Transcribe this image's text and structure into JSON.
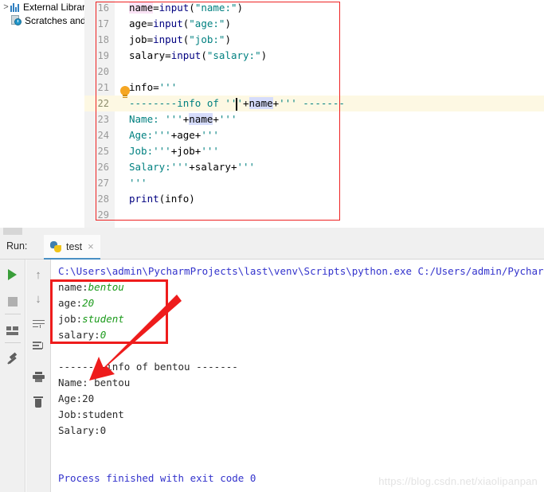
{
  "editor": {
    "line_start": 16,
    "current_line": 22,
    "lines": [
      {
        "num": 16,
        "tokens": [
          {
            "t": "name",
            "c": "plain hl-pink"
          },
          {
            "t": "=",
            "c": "plain"
          },
          {
            "t": "input",
            "c": "kw-fn"
          },
          {
            "t": "(",
            "c": "plain"
          },
          {
            "t": "\"name:\"",
            "c": "str"
          },
          {
            "t": ")",
            "c": "plain"
          }
        ]
      },
      {
        "num": 17,
        "tokens": [
          {
            "t": "age",
            "c": "plain"
          },
          {
            "t": "=",
            "c": "plain"
          },
          {
            "t": "input",
            "c": "kw-fn"
          },
          {
            "t": "(",
            "c": "plain"
          },
          {
            "t": "\"age:\"",
            "c": "str"
          },
          {
            "t": ")",
            "c": "plain"
          }
        ]
      },
      {
        "num": 18,
        "tokens": [
          {
            "t": "job",
            "c": "plain"
          },
          {
            "t": "=",
            "c": "plain"
          },
          {
            "t": "input",
            "c": "kw-fn"
          },
          {
            "t": "(",
            "c": "plain"
          },
          {
            "t": "\"job:\"",
            "c": "str"
          },
          {
            "t": ")",
            "c": "plain"
          }
        ]
      },
      {
        "num": 19,
        "tokens": [
          {
            "t": "salary",
            "c": "plain"
          },
          {
            "t": "=",
            "c": "plain"
          },
          {
            "t": "input",
            "c": "kw-fn"
          },
          {
            "t": "(",
            "c": "plain"
          },
          {
            "t": "\"salary:\"",
            "c": "str"
          },
          {
            "t": ")",
            "c": "plain"
          }
        ]
      },
      {
        "num": 20,
        "tokens": []
      },
      {
        "num": 21,
        "tokens": [
          {
            "t": "info",
            "c": "plain"
          },
          {
            "t": "=",
            "c": "plain"
          },
          {
            "t": "'''",
            "c": "str"
          }
        ]
      },
      {
        "num": 22,
        "tokens": [
          {
            "t": "--------info of '''",
            "c": "str"
          },
          {
            "t": "+",
            "c": "plain"
          },
          {
            "t": "name",
            "c": "plain hl-blue"
          },
          {
            "t": "+",
            "c": "plain"
          },
          {
            "t": "''' -------",
            "c": "str"
          }
        ]
      },
      {
        "num": 23,
        "tokens": [
          {
            "t": "Name: '''",
            "c": "str"
          },
          {
            "t": "+",
            "c": "plain"
          },
          {
            "t": "name",
            "c": "plain hl-blue"
          },
          {
            "t": "+",
            "c": "plain"
          },
          {
            "t": "'''",
            "c": "str"
          }
        ]
      },
      {
        "num": 24,
        "tokens": [
          {
            "t": "Age:'''",
            "c": "str"
          },
          {
            "t": "+",
            "c": "plain"
          },
          {
            "t": "age",
            "c": "plain"
          },
          {
            "t": "+",
            "c": "plain"
          },
          {
            "t": "'''",
            "c": "str"
          }
        ]
      },
      {
        "num": 25,
        "tokens": [
          {
            "t": "Job:'''",
            "c": "str"
          },
          {
            "t": "+",
            "c": "plain"
          },
          {
            "t": "job",
            "c": "plain"
          },
          {
            "t": "+",
            "c": "plain"
          },
          {
            "t": "'''",
            "c": "str"
          }
        ]
      },
      {
        "num": 26,
        "tokens": [
          {
            "t": "Salary:'''",
            "c": "str"
          },
          {
            "t": "+",
            "c": "plain"
          },
          {
            "t": "salary",
            "c": "plain"
          },
          {
            "t": "+",
            "c": "plain"
          },
          {
            "t": "'''",
            "c": "str"
          }
        ]
      },
      {
        "num": 27,
        "tokens": [
          {
            "t": "'''",
            "c": "str"
          }
        ]
      },
      {
        "num": 28,
        "tokens": [
          {
            "t": "print",
            "c": "kw-fn"
          },
          {
            "t": "(",
            "c": "plain"
          },
          {
            "t": "info",
            "c": "plain"
          },
          {
            "t": ")",
            "c": "plain"
          }
        ]
      },
      {
        "num": 29,
        "tokens": []
      }
    ],
    "lightbulb_icon": "lightbulb-icon",
    "caret": "text-caret"
  },
  "project_tree": {
    "external_libraries": "External Libraries",
    "external_arrow": ">",
    "external_icon": "library-bars-icon",
    "scratches": "Scratches and Consoles",
    "scratches_icon": "scratches-clock-icon"
  },
  "run_panel": {
    "label": "Run:",
    "tab_label": "test",
    "tab_close": "×",
    "tab_icon": "python-logo-icon",
    "toolbar_left": [
      {
        "name": "rerun-button",
        "icon": "play-icon"
      },
      {
        "name": "stop-button",
        "icon": "stop-square-icon"
      },
      {
        "name": "layout-button",
        "icon": "layout-icon"
      },
      {
        "name": "pin-tab-button",
        "icon": "pin-icon"
      }
    ],
    "toolbar_right": [
      {
        "name": "prev-occurrence-button",
        "icon": "arrow-up-icon",
        "glyph": "↑"
      },
      {
        "name": "next-occurrence-button",
        "icon": "arrow-down-icon",
        "glyph": "↓"
      },
      {
        "name": "soft-wrap-button",
        "icon": "soft-wrap-icon"
      },
      {
        "name": "scroll-to-end-button",
        "icon": "scroll-to-end-icon"
      },
      {
        "name": "print-button",
        "icon": "printer-icon"
      },
      {
        "name": "clear-all-button",
        "icon": "trash-icon"
      }
    ]
  },
  "console": {
    "lines": [
      {
        "segments": [
          {
            "t": "C:\\Users\\admin\\PycharmProjects\\last\\venv\\Scripts\\python.exe C:/Users/admin/PycharmProje",
            "c": "c-cmd"
          }
        ]
      },
      {
        "segments": [
          {
            "t": "name:",
            "c": ""
          },
          {
            "t": "bentou",
            "c": "c-input"
          }
        ]
      },
      {
        "segments": [
          {
            "t": "age:",
            "c": ""
          },
          {
            "t": "20",
            "c": "c-input"
          }
        ]
      },
      {
        "segments": [
          {
            "t": "job:",
            "c": ""
          },
          {
            "t": "student",
            "c": "c-input"
          }
        ]
      },
      {
        "segments": [
          {
            "t": "salary:",
            "c": ""
          },
          {
            "t": "0",
            "c": "c-input"
          }
        ]
      },
      {
        "segments": []
      },
      {
        "segments": [
          {
            "t": "--------info of bentou -------",
            "c": ""
          }
        ]
      },
      {
        "segments": [
          {
            "t": "Name: bentou",
            "c": ""
          }
        ]
      },
      {
        "segments": [
          {
            "t": "Age:20",
            "c": ""
          }
        ]
      },
      {
        "segments": [
          {
            "t": "Job:student",
            "c": ""
          }
        ]
      },
      {
        "segments": [
          {
            "t": "Salary:0",
            "c": ""
          }
        ]
      },
      {
        "segments": []
      },
      {
        "segments": []
      },
      {
        "segments": [
          {
            "t": "Process finished with exit code 0",
            "c": "c-exit"
          }
        ]
      }
    ]
  },
  "annotations": {
    "code_box_color": "#ee2222",
    "console_box_color": "#ee1c1c",
    "arrow_color": "#ee1c1c"
  },
  "watermark": {
    "text": "https://blog.csdn.net/xiaolipanpan",
    "color": "#e3e3e3"
  }
}
